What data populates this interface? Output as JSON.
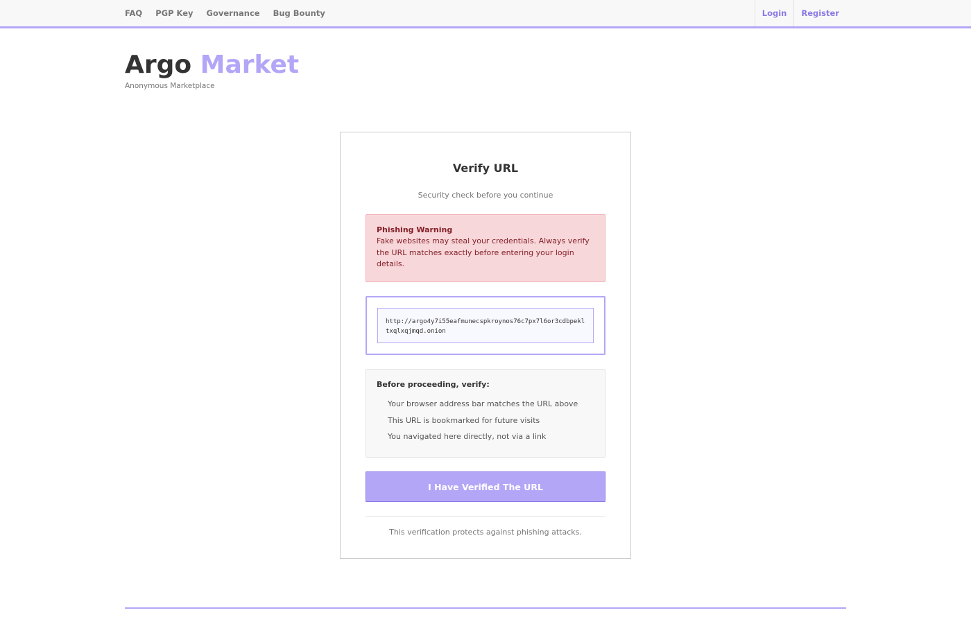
{
  "nav": {
    "left": [
      "FAQ",
      "PGP Key",
      "Governance",
      "Bug Bounty"
    ],
    "right": [
      "Login",
      "Register"
    ]
  },
  "brand": {
    "name_main": "Argo",
    "name_accent": "Market",
    "tagline": "Anonymous Marketplace"
  },
  "card": {
    "title": "Verify URL",
    "subtitle": "Security check before you continue",
    "warning": {
      "title": "Phishing Warning",
      "text": "Fake websites may steal your credentials. Always verify the URL matches exactly before entering your login details."
    },
    "url": "http://argo4y7i55eafmunecspkroynos76c7px7l6or3cdbpekltxqlxqjmqd.onion",
    "checklist": {
      "title": "Before proceeding, verify:",
      "items": [
        "Your browser address bar matches the URL above",
        "This URL is bookmarked for future visits",
        "You navigated here directly, not via a link"
      ]
    },
    "button_label": "I Have Verified The URL",
    "footer_note": "This verification protects against phishing attacks."
  },
  "colors": {
    "accent": "#b3a6f7",
    "link": "#8a79e6",
    "danger_bg": "#f8d7da",
    "danger_text": "#842029"
  }
}
